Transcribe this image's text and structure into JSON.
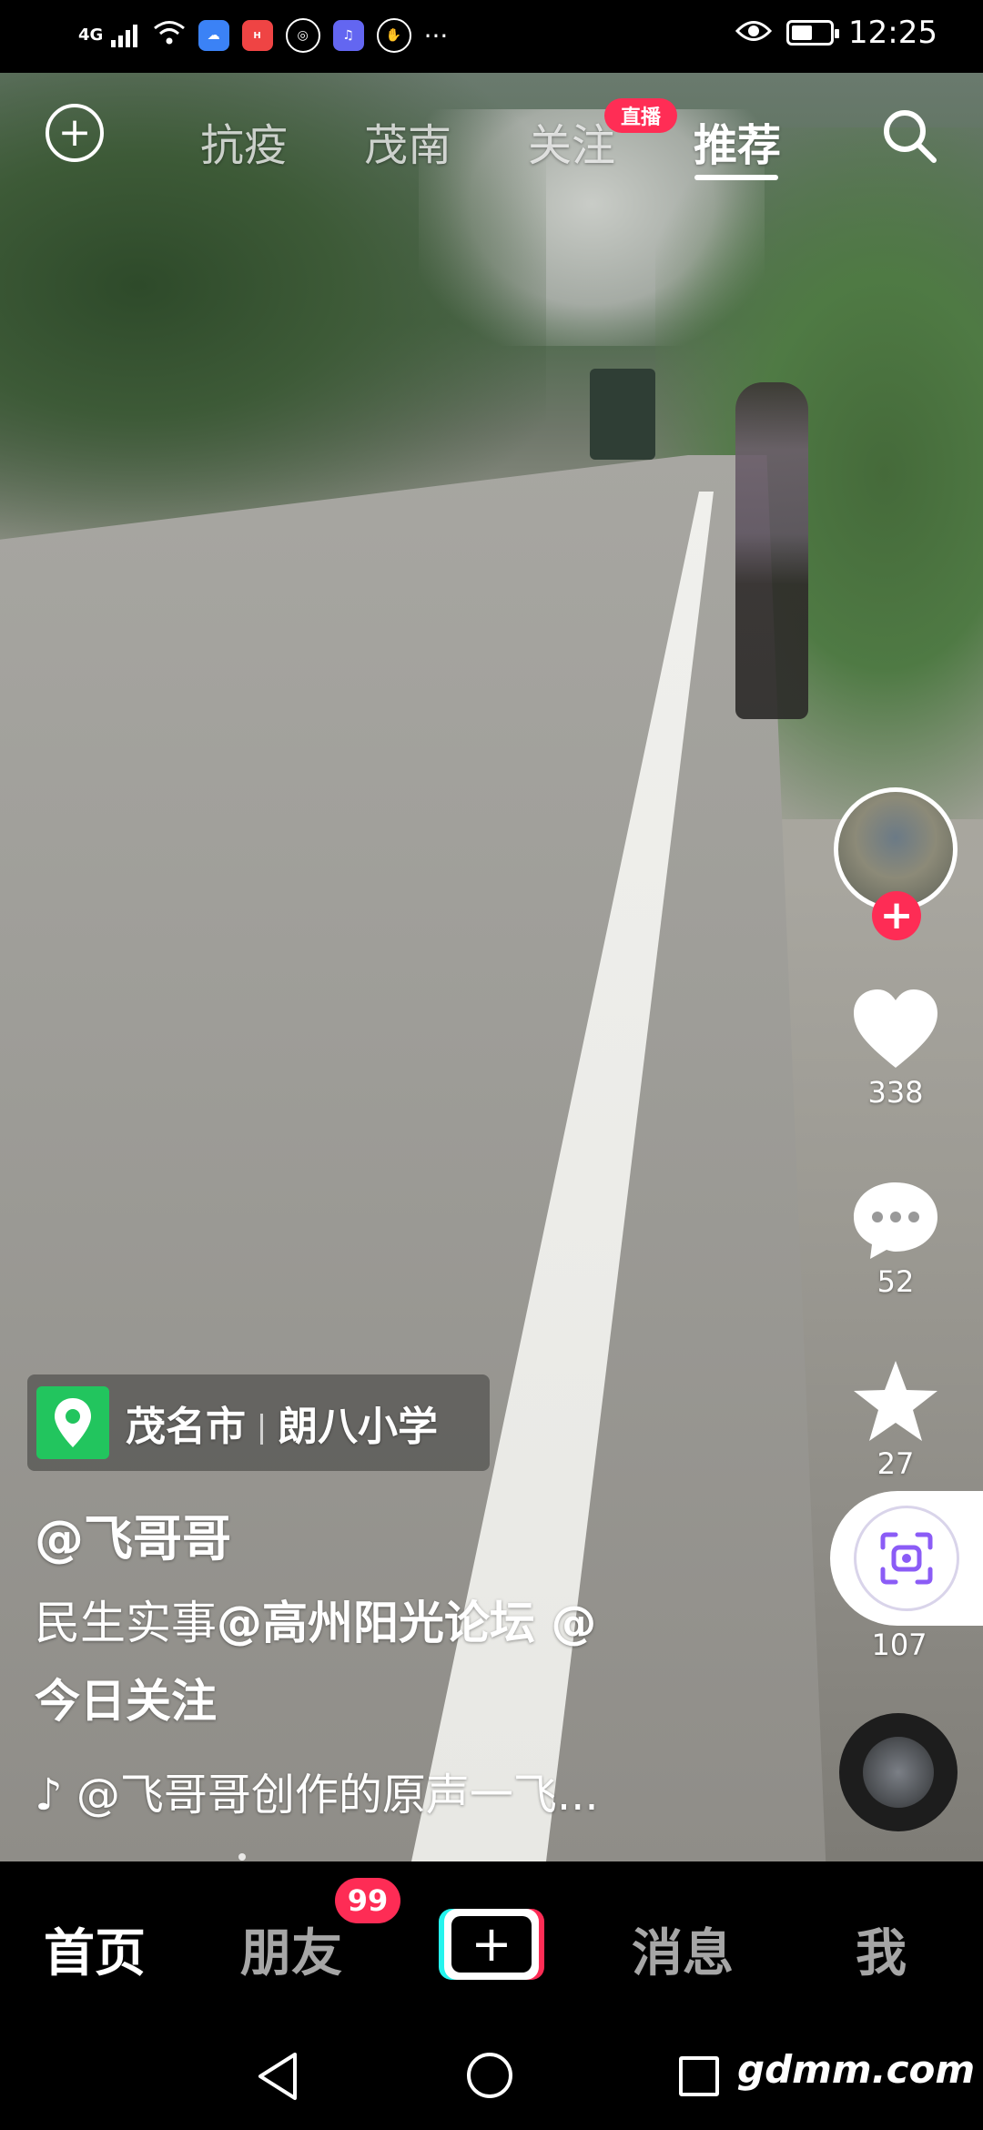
{
  "status_bar": {
    "network": "4G",
    "time": "12:25",
    "more": "···"
  },
  "top_nav": {
    "tabs": [
      "抗疫",
      "茂南",
      "关注",
      "推荐"
    ],
    "active_tab": "推荐",
    "live_badge": "直播"
  },
  "actions": {
    "likes": "338",
    "comments": "52",
    "favorites": "27",
    "shares": "107"
  },
  "post": {
    "location_city": "茂名市",
    "location_place": "朗八小学",
    "author": "@飞哥哥",
    "desc_text": "民生实事",
    "desc_tag1": "@高州阳光论坛",
    "desc_tag2_prefix": " @",
    "desc_line2": "今日关注",
    "music": "♪ @飞哥哥创作的原声一飞..."
  },
  "bottom_tabs": {
    "home": "首页",
    "friends": "朋友",
    "friends_badge": "99",
    "messages": "消息",
    "me": "我"
  },
  "watermark": "gdmm.com",
  "colors": {
    "accent_red": "#fe2c55",
    "accent_cyan": "#25f4ee",
    "location_green": "#22c55e"
  }
}
